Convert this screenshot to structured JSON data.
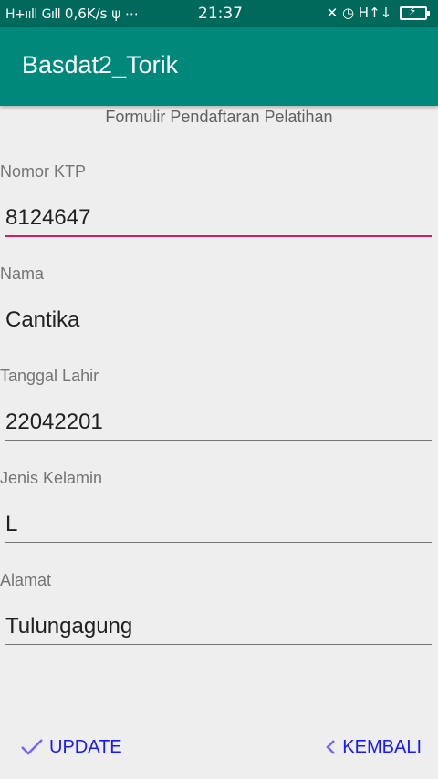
{
  "status_bar": {
    "signal_1": "H+ııll",
    "signal_2": "Gıll",
    "speed": "0,6K/s",
    "usb": "ψ",
    "more": "⋯",
    "time": "21:37",
    "right_icons": "✕ ◷ H↑↓",
    "battery_bolt": "⚡"
  },
  "app_bar": {
    "title": "Basdat2_Torik",
    "color": "#00897b"
  },
  "form": {
    "title": "Formulir Pendaftaran Pelatihan",
    "fields": [
      {
        "label": "Nomor KTP",
        "value": "8124647"
      },
      {
        "label": "Nama",
        "value": "Cantika"
      },
      {
        "label": "Tanggal Lahir",
        "value": "22042201"
      },
      {
        "label": "Jenis Kelamin",
        "value": "L"
      },
      {
        "label": "Alamat",
        "value": "Tulungagung"
      }
    ]
  },
  "actions": {
    "update_label": "UPDATE",
    "update_icon": "check-icon",
    "back_label": "KEMBALI",
    "back_icon": "chevron-left-icon",
    "accent": "#d81b60",
    "button_color": "#1a1aff"
  }
}
